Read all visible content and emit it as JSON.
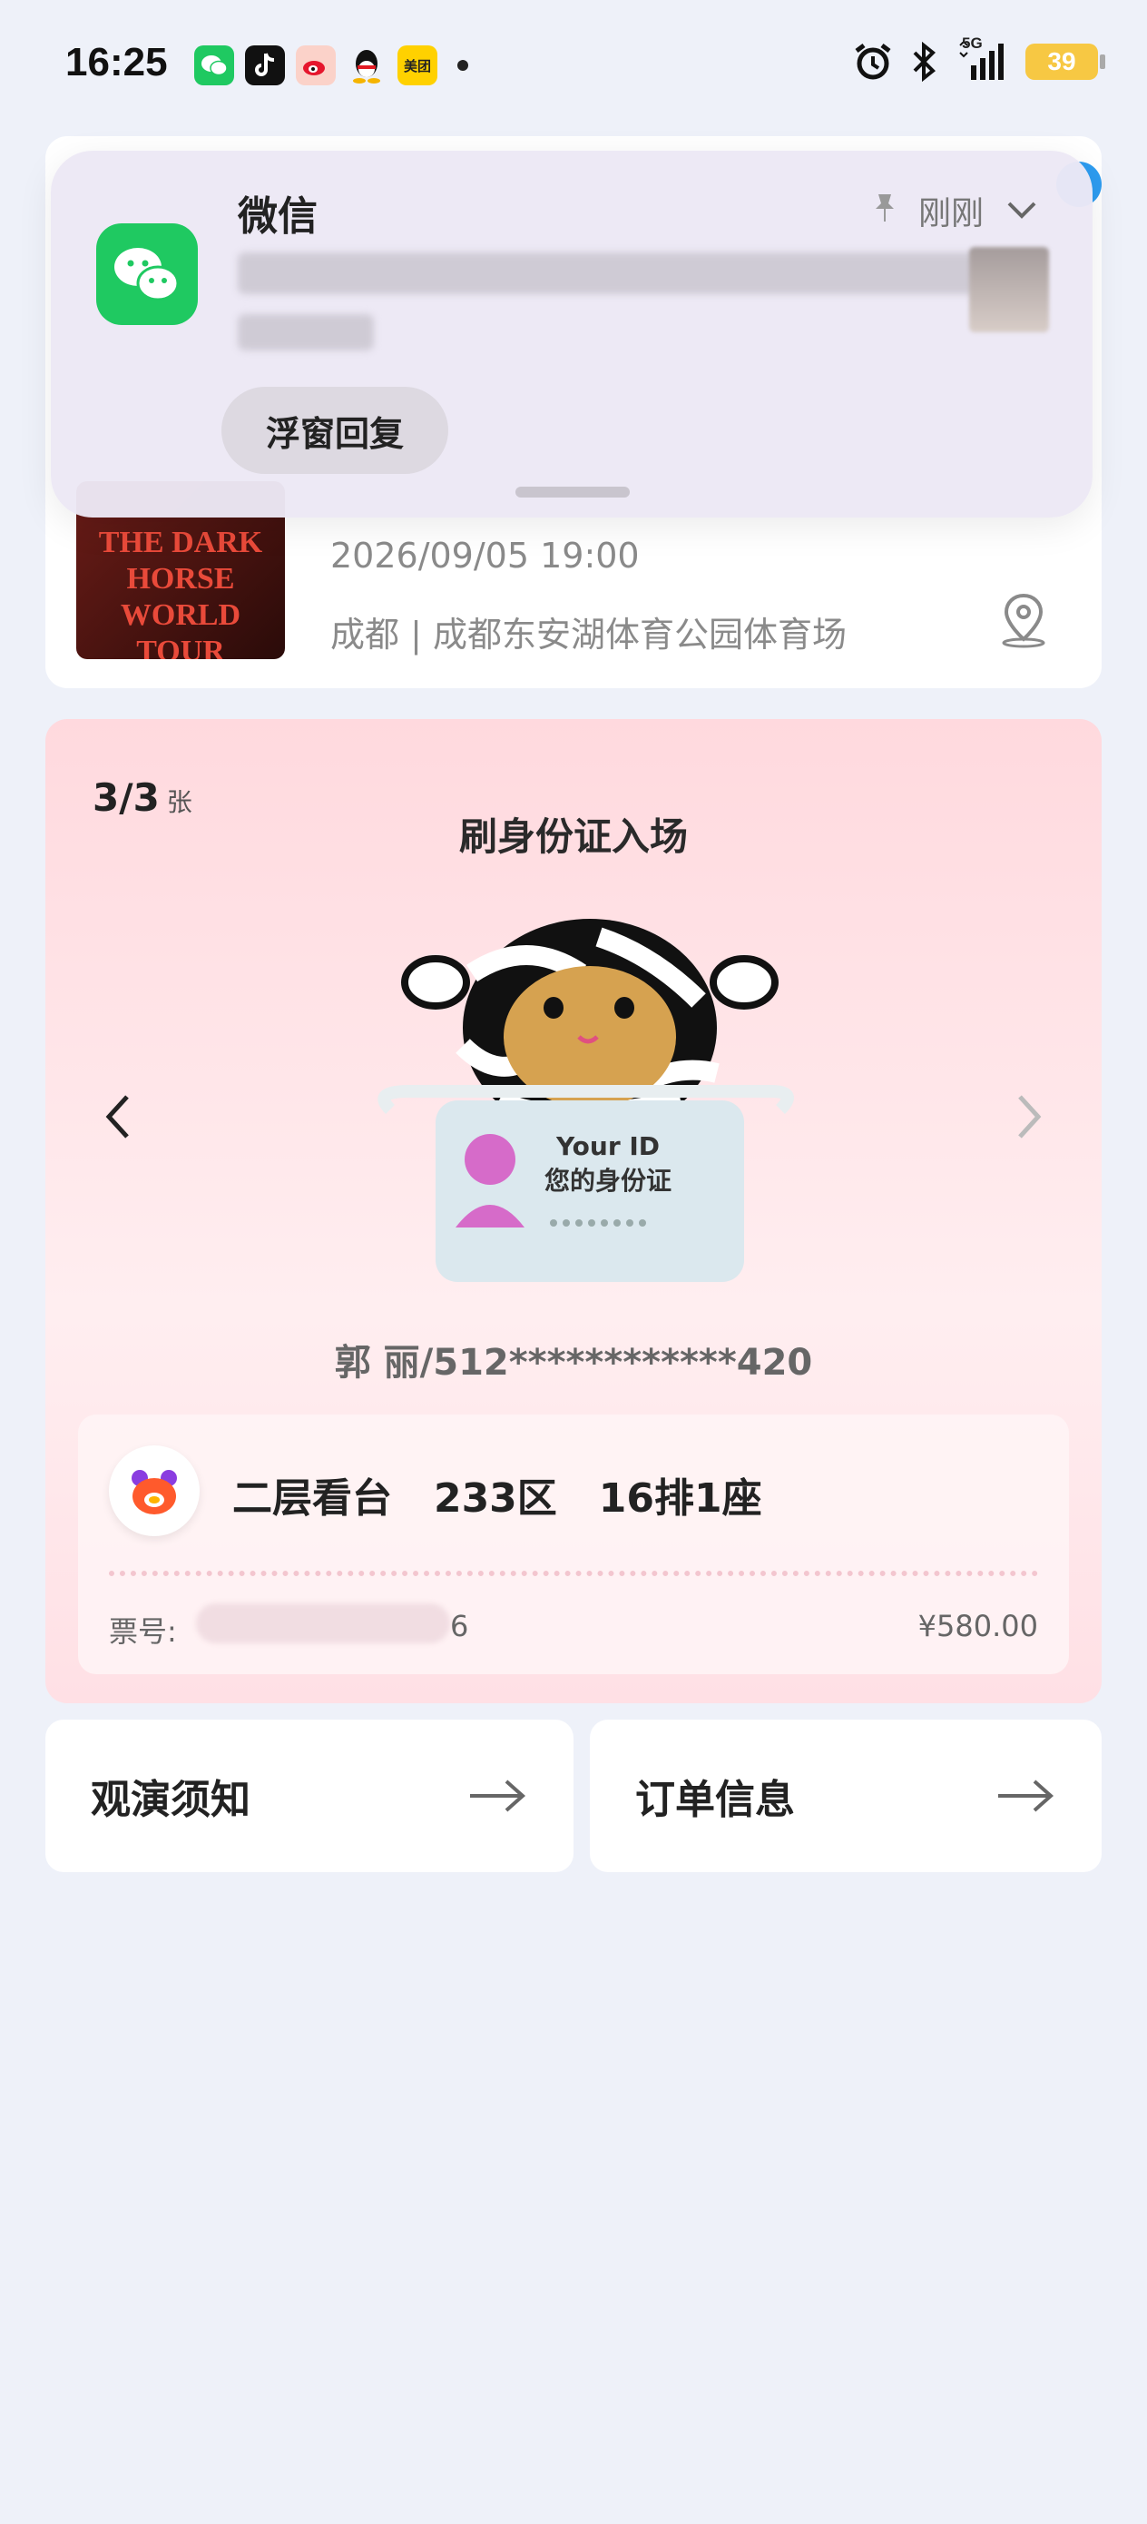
{
  "status_bar": {
    "time": "16:25",
    "app_icons": [
      "wechat-icon",
      "douyin-icon",
      "weibo-icon",
      "qq-icon",
      "meituan-icon"
    ],
    "meituan_label": "美团",
    "network": "5G",
    "battery": "39"
  },
  "notification": {
    "app_name": "微信",
    "time": "刚刚",
    "reply_label": "浮窗回复"
  },
  "event": {
    "poster_title": "THE DARK HORSE WORLD TOUR",
    "datetime": "2026/09/05 19:00",
    "venue": "成都 | 成都东安湖体育公园体育场"
  },
  "ticket": {
    "count": "3/3",
    "count_unit": "张",
    "entry_method": "刷身份证入场",
    "id_card_title": "Your ID",
    "id_card_subtitle": "您的身份证",
    "holder": "郭 丽/512************420",
    "seat": "二层看台   233区   16排1座",
    "ticket_no_label": "票号:",
    "ticket_no_tail": "6",
    "price": "¥580.00"
  },
  "actions": {
    "notice_label": "观演须知",
    "order_label": "订单信息"
  },
  "colors": {
    "background": "#eef1f9",
    "wechat_green": "#1fc961",
    "battery": "#f7c843",
    "ticket_pink": "#ffd9de"
  }
}
